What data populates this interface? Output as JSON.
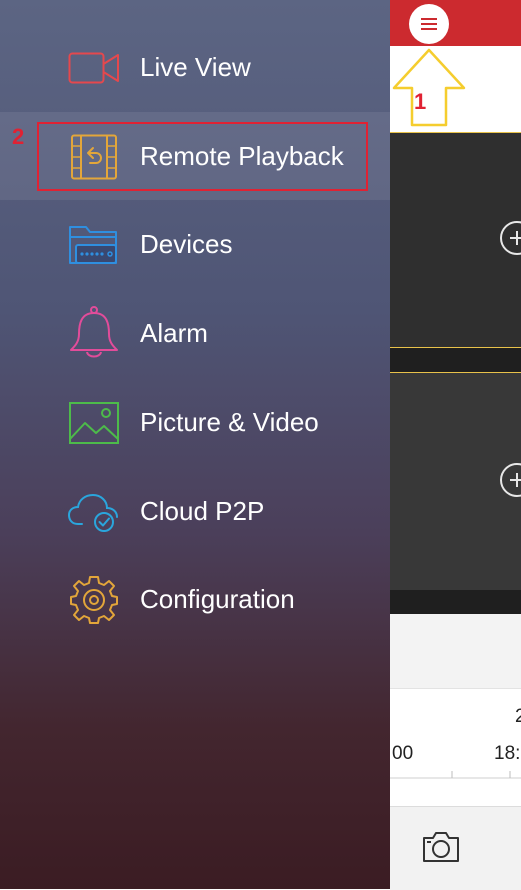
{
  "menu": {
    "items": [
      {
        "label": "Live View",
        "icon": "video-camera-icon",
        "color": "#e5484d"
      },
      {
        "label": "Remote Playback",
        "icon": "film-playback-icon",
        "color": "#e3a63a"
      },
      {
        "label": "Devices",
        "icon": "folder-dvr-icon",
        "color": "#2f8fe0"
      },
      {
        "label": "Alarm",
        "icon": "bell-icon",
        "color": "#e24c9a"
      },
      {
        "label": "Picture & Video",
        "icon": "picture-icon",
        "color": "#4dbb4a"
      },
      {
        "label": "Cloud P2P",
        "icon": "cloud-check-icon",
        "color": "#2aa6dd"
      },
      {
        "label": "Configuration",
        "icon": "gear-icon",
        "color": "#e3a63a"
      }
    ],
    "selected_index": 1
  },
  "annotations": {
    "step1": "1",
    "step2": "2",
    "highlight_color": "#e02233",
    "arrow_color": "#f5cd2e"
  },
  "timeline": {
    "hour_label_partial": "2",
    "time_left": "00",
    "time_right": "18:"
  },
  "colors": {
    "header": "#cc2a2f"
  }
}
